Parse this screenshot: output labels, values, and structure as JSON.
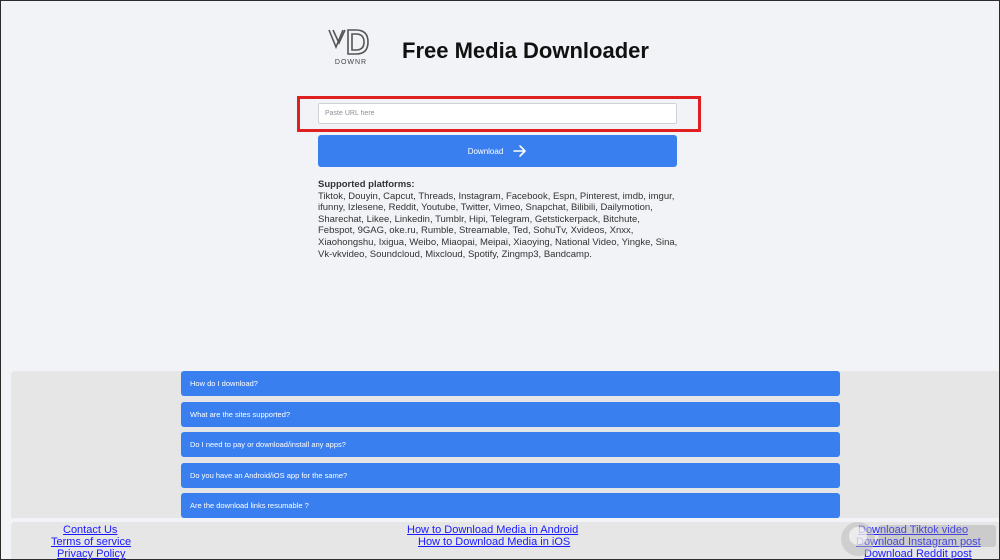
{
  "brand": {
    "logo_text": "DOWNR",
    "title": "Free Media Downloader"
  },
  "url_input": {
    "placeholder": "Paste URL here",
    "value": ""
  },
  "download_button": {
    "label": "Download"
  },
  "platforms": {
    "heading": "Supported platforms:",
    "list": "Tiktok, Douyin, Capcut, Threads, Instagram, Facebook, Espn, Pinterest, imdb, imgur, ifunny, Izlesene, Reddit, Youtube, Twitter, Vimeo, Snapchat, Bilibili, Dailymotion, Sharechat, Likee, Linkedin, Tumblr, Hipi, Telegram, Getstickerpack, Bitchute, Febspot, 9GAG, oke.ru, Rumble, Streamable, Ted, SohuTv, Xvideos, Xnxx, Xiaohongshu, Ixigua, Weibo, Miaopai, Meipai, Xiaoying, National Video, Yingke, Sina, Vk-vkvideo, Soundcloud, Mixcloud, Spotify, Zingmp3, Bandcamp."
  },
  "faq": [
    "How do I download?",
    "What are the sites supported?",
    "Do I need to pay or download/install any apps?",
    "Do you have an Android/iOS app for the same?",
    "Are the download links resumable ?"
  ],
  "footer": {
    "left": [
      "Contact Us",
      "Terms of service",
      "Privacy Policy"
    ],
    "center": [
      "How to Download Media in Android",
      "How to Download Media in iOS"
    ],
    "right": [
      "Download Tiktok video",
      "Download Instagram post",
      "Download Reddit post"
    ]
  },
  "colors": {
    "accent": "#3a7ff0",
    "highlight": "#e02020",
    "link": "#1a1aff"
  }
}
